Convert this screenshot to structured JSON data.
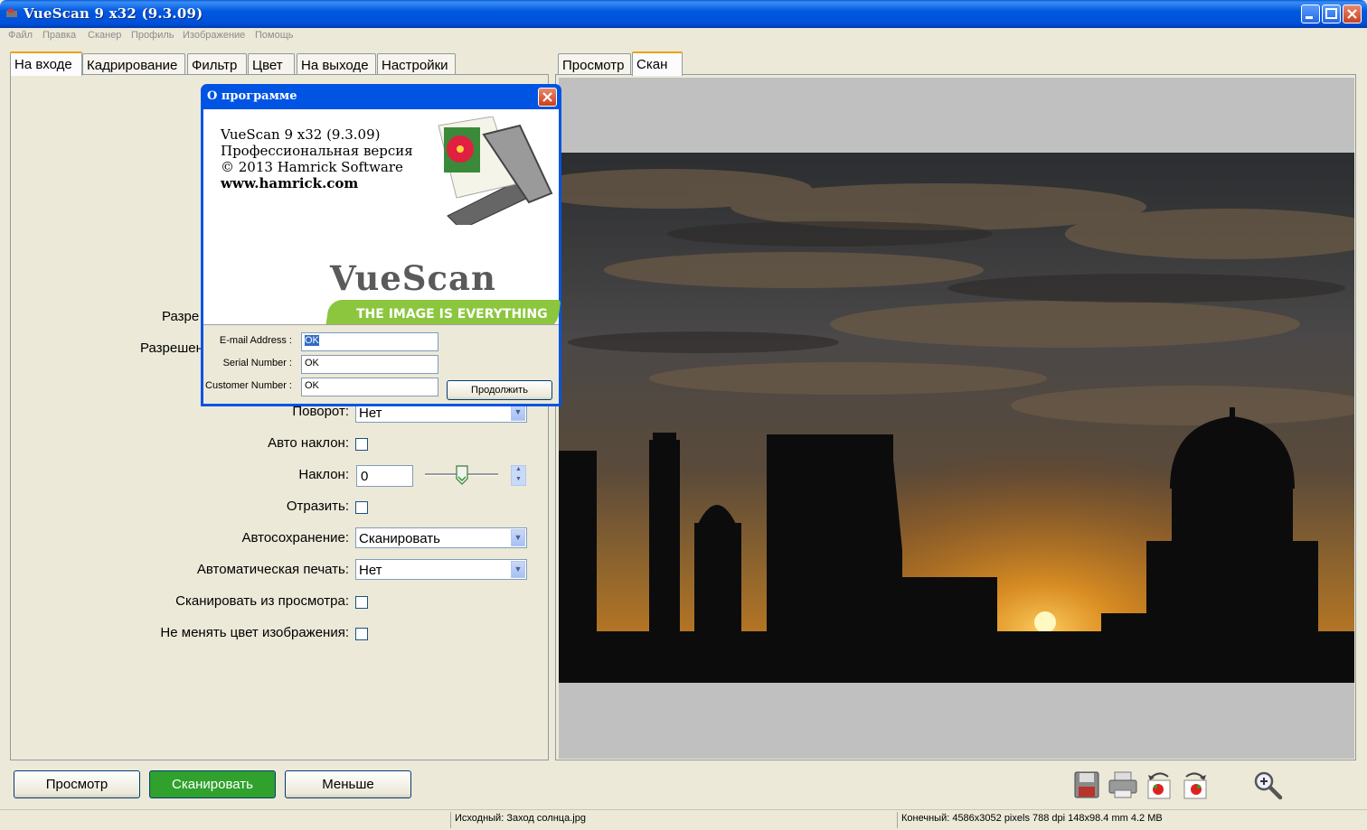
{
  "window": {
    "title": "VueScan 9 x32 (9.3.09)"
  },
  "menu": [
    "Файл",
    "Правка",
    "Сканер",
    "Профиль",
    "Изображение",
    "Помощь"
  ],
  "left_tabs": [
    "На входе",
    "Кадрирование",
    "Фильтр",
    "Цвет",
    "На выходе",
    "Настройки"
  ],
  "right_tabs": [
    "Просмотр",
    "Скан"
  ],
  "form": {
    "res_label_1": "Разре",
    "res_label_2": "Разрешен",
    "rotation_label": "Поворот:",
    "rotation_value": "Нет",
    "auto_skew_label": "Авто наклон:",
    "skew_label": "Наклон:",
    "skew_value": "0",
    "mirror_label": "Отразить:",
    "autosave_label": "Автосохранение:",
    "autosave_value": "Сканировать",
    "autoprint_label": "Автоматическая печать:",
    "autoprint_value": "Нет",
    "scan_from_preview_label": "Сканировать из просмотра:",
    "keep_colors_label": "Не менять цвет изображения:"
  },
  "buttons": {
    "preview": "Просмотр",
    "scan": "Сканировать",
    "less": "Меньше"
  },
  "status": {
    "source": "Исходный: Заход солнца.jpg",
    "output": "Конечный: 4586x3052 pixels 788 dpi 148x98.4 mm 4.2 MB"
  },
  "dialog": {
    "title": "О программе",
    "line1": "VueScan 9 x32 (9.3.09)",
    "line2": "Профессиональная версия",
    "line3": "© 2013 Hamrick Software",
    "line4": "www.hamrick.com",
    "logo_text": "VueScan",
    "tagline": "THE IMAGE IS EVERYTHING",
    "email_label": "E-mail Address :",
    "email_value": "OK",
    "serial_label": "Serial Number :",
    "serial_value": "OK",
    "customer_label": "Customer Number :",
    "customer_value": "OK",
    "continue_button": "Продолжить"
  },
  "toolbar_icons": [
    "save-icon",
    "print-icon",
    "rotate-left-icon",
    "rotate-right-icon",
    "zoom-in-icon"
  ],
  "colors": {
    "titlebar": "#0054e3",
    "scan_button": "#2fa12c",
    "active_tab_accent": "#f0a000"
  }
}
